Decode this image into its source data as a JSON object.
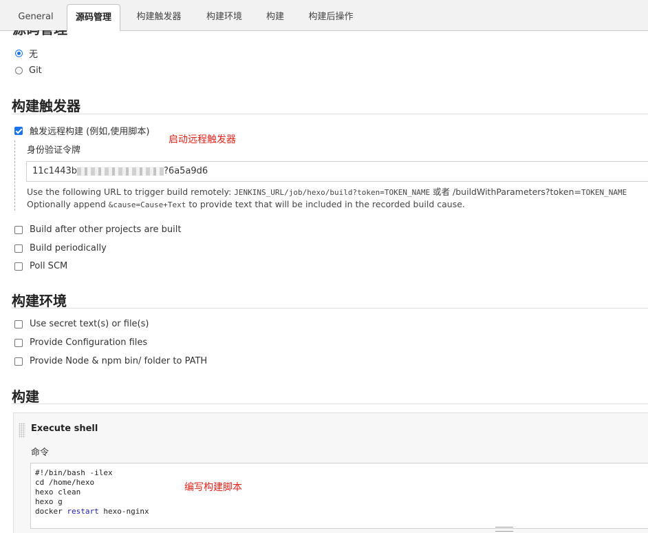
{
  "tabs": [
    {
      "label": "General",
      "active": false
    },
    {
      "label": "源码管理",
      "active": true
    },
    {
      "label": "构建触发器",
      "active": false
    },
    {
      "label": "构建环境",
      "active": false
    },
    {
      "label": "构建",
      "active": false
    },
    {
      "label": "构建后操作",
      "active": false
    }
  ],
  "scm": {
    "title": "源码管理",
    "options": [
      {
        "label": "无",
        "selected": true
      },
      {
        "label": "Git",
        "selected": false
      }
    ]
  },
  "triggers": {
    "title": "构建触发器",
    "remote": {
      "label": "触发远程构建 (例如,使用脚本)",
      "checked": true,
      "token_label": "身份验证令牌",
      "token_prefix": "11c1443b",
      "token_suffix": "?6a5a9d6",
      "help_line1_prefix": "Use the following URL to trigger build remotely: ",
      "help_line1_code1": "JENKINS_URL/job/hexo/build?token=TOKEN_NAME",
      "help_line1_mid": " 或者 ",
      "help_line1_path": "/buildWithParameters?token=",
      "help_line1_code2": "TOKEN_NAME",
      "help_line2_prefix": "Optionally append ",
      "help_line2_code": "&cause=Cause+Text",
      "help_line2_suffix": " to provide text that will be included in the recorded build cause."
    },
    "others": [
      {
        "label": "Build after other projects are built",
        "checked": false
      },
      {
        "label": "Build periodically",
        "checked": false
      },
      {
        "label": "Poll SCM",
        "checked": false
      }
    ],
    "annotation": "启动远程触发器"
  },
  "environment": {
    "title": "构建环境",
    "options": [
      {
        "label": "Use secret text(s) or file(s)",
        "checked": false
      },
      {
        "label": "Provide Configuration files",
        "checked": false
      },
      {
        "label": "Provide Node & npm bin/ folder to PATH",
        "checked": false
      }
    ]
  },
  "build": {
    "title": "构建",
    "step_title": "Execute shell",
    "command_label": "命令",
    "script_lines": [
      "#!/bin/bash -ilex",
      "cd /home/hexo",
      "hexo clean",
      "hexo g",
      "docker restart hexo-nginx"
    ],
    "annotation": "编写构建脚本"
  },
  "colors": {
    "accent": "#1a73e8",
    "annotation": "#e0241b"
  }
}
